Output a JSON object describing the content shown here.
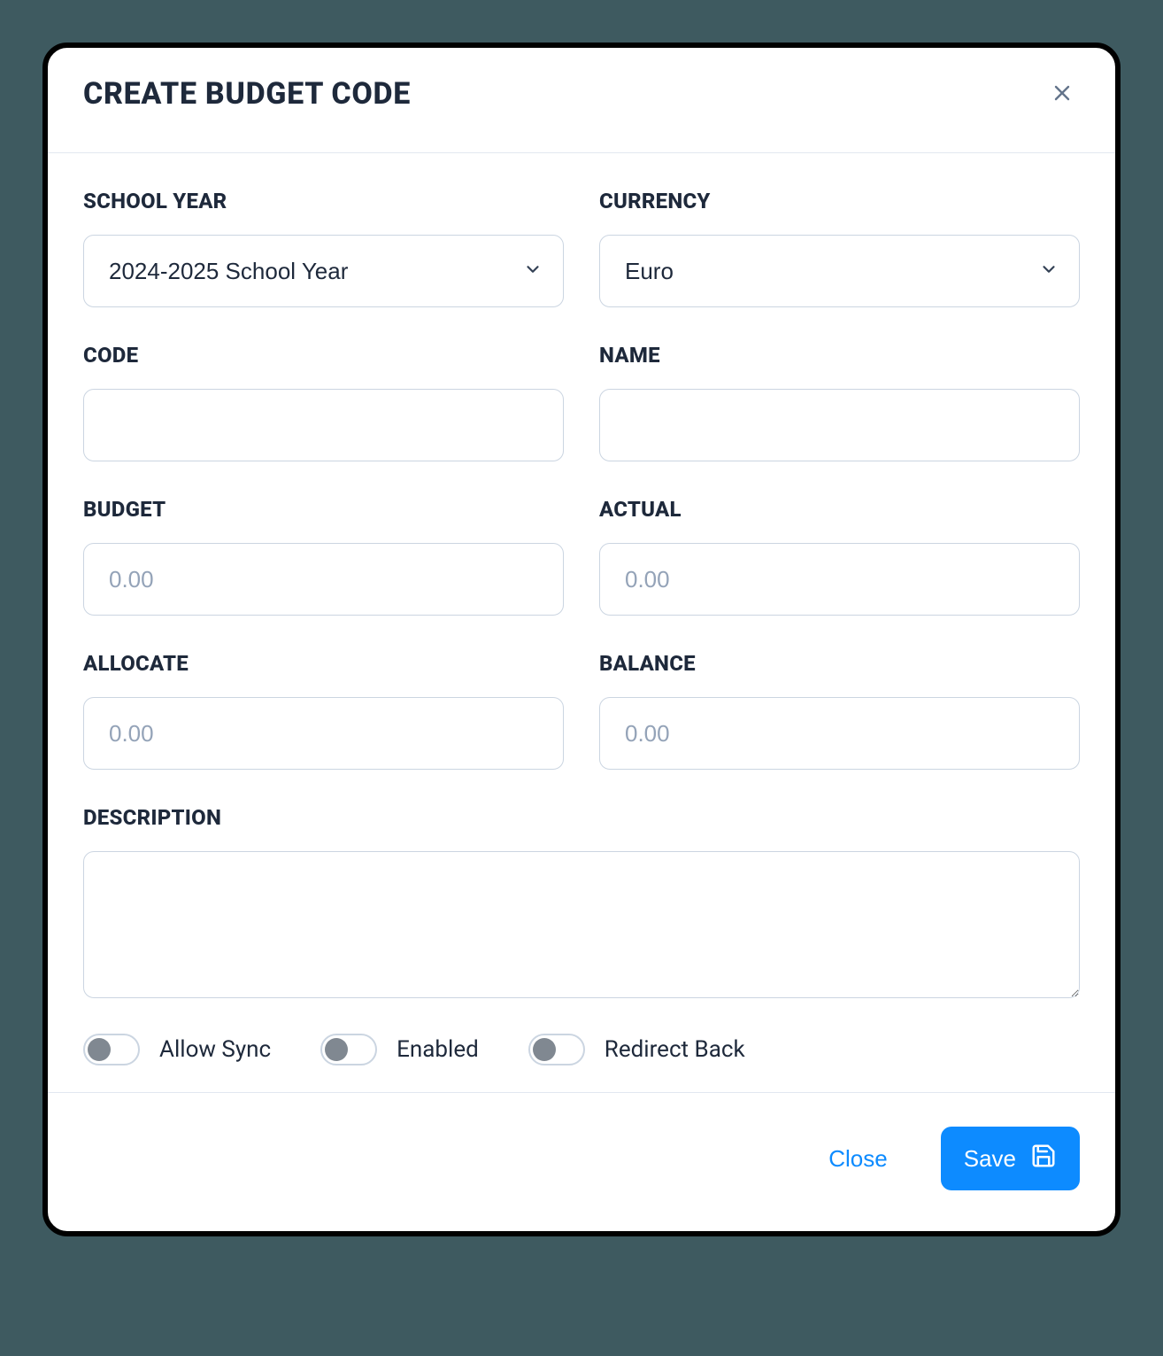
{
  "modal": {
    "title": "CREATE BUDGET CODE",
    "fields": {
      "school_year": {
        "label": "SCHOOL YEAR",
        "value": "2024-2025 School Year"
      },
      "currency": {
        "label": "CURRENCY",
        "value": "Euro"
      },
      "code": {
        "label": "CODE",
        "value": ""
      },
      "name": {
        "label": "NAME",
        "value": ""
      },
      "budget": {
        "label": "BUDGET",
        "value": "",
        "placeholder": "0.00"
      },
      "actual": {
        "label": "ACTUAL",
        "value": "",
        "placeholder": "0.00"
      },
      "allocate": {
        "label": "ALLOCATE",
        "value": "",
        "placeholder": "0.00"
      },
      "balance": {
        "label": "BALANCE",
        "value": "",
        "placeholder": "0.00"
      },
      "description": {
        "label": "DESCRIPTION",
        "value": ""
      }
    },
    "toggles": {
      "allow_sync": {
        "label": "Allow Sync",
        "on": false
      },
      "enabled": {
        "label": "Enabled",
        "on": false
      },
      "redirect_back": {
        "label": "Redirect Back",
        "on": false
      }
    },
    "footer": {
      "close": "Close",
      "save": "Save"
    }
  }
}
